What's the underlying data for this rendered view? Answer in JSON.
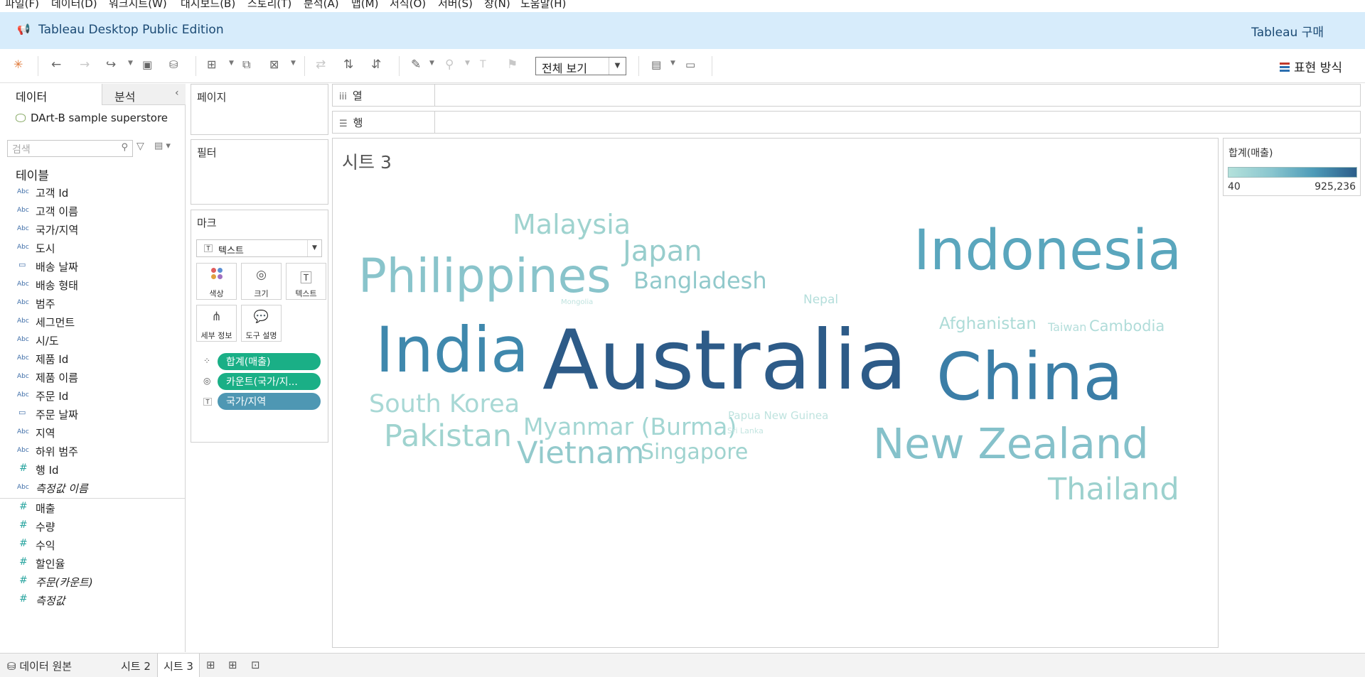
{
  "menu": [
    "파일(F)",
    "데이터(D)",
    "워크시트(W)",
    "대시보드(B)",
    "스토리(T)",
    "분석(A)",
    "맵(M)",
    "서식(O)",
    "서버(S)",
    "창(N)",
    "도움말(H)"
  ],
  "app": {
    "title": "Tableau Desktop Public Edition",
    "buy_label": "Tableau 구매"
  },
  "toolbar": {
    "view_select": "전체 보기",
    "show_me": "표현 방식"
  },
  "datapane": {
    "tab_data": "데이터",
    "tab_analysis": "분석",
    "datasource": "DArt-B sample superstore",
    "search_placeholder": "검색",
    "tables_title": "테이블",
    "dimensions": [
      {
        "type": "Abc",
        "name": "고객 Id"
      },
      {
        "type": "Abc",
        "name": "고객 이름"
      },
      {
        "type": "Abc",
        "name": "국가/지역"
      },
      {
        "type": "Abc",
        "name": "도시"
      },
      {
        "type": "date",
        "name": "배송 날짜"
      },
      {
        "type": "Abc",
        "name": "배송 형태"
      },
      {
        "type": "Abc",
        "name": "범주"
      },
      {
        "type": "Abc",
        "name": "세그먼트"
      },
      {
        "type": "Abc",
        "name": "시/도"
      },
      {
        "type": "Abc",
        "name": "제품 Id"
      },
      {
        "type": "Abc",
        "name": "제품 이름"
      },
      {
        "type": "Abc",
        "name": "주문 Id"
      },
      {
        "type": "date",
        "name": "주문 날짜"
      },
      {
        "type": "Abc",
        "name": "지역"
      },
      {
        "type": "Abc",
        "name": "하위 범주"
      },
      {
        "type": "#",
        "name": "행 Id"
      },
      {
        "type": "Abc",
        "name": "측정값 이름",
        "italic": true
      }
    ],
    "measures": [
      {
        "type": "#",
        "name": "매출"
      },
      {
        "type": "#",
        "name": "수량"
      },
      {
        "type": "#",
        "name": "수익"
      },
      {
        "type": "#",
        "name": "할인율"
      },
      {
        "type": "#",
        "name": "주문(카운트)",
        "italic": true
      },
      {
        "type": "#",
        "name": "측정값",
        "italic": true
      }
    ]
  },
  "cards": {
    "pages": "페이지",
    "filters": "필터",
    "marks": "마크",
    "mark_type": "텍스트",
    "mark_buttons": [
      "색상",
      "크기",
      "텍스트",
      "세부 정보",
      "도구 설명"
    ],
    "pills": [
      {
        "icon": "color-dots-icon",
        "label": "합계(매출)",
        "color": "#1aaf86"
      },
      {
        "icon": "size-icon",
        "label": "카운트(국가/지...",
        "color": "#1aaf86"
      },
      {
        "icon": "text-icon",
        "label": "국가/지역",
        "color": "#4e97b3"
      }
    ]
  },
  "shelves": {
    "columns": "열",
    "rows": "행"
  },
  "sheet": {
    "title": "시트 3"
  },
  "legend": {
    "title": "합계(매출)",
    "min": "40",
    "max": "925,236"
  },
  "wordcloud": [
    {
      "word": "Malaysia",
      "color": "#9fd3cf"
    },
    {
      "word": "Japan",
      "color": "#97cdcc"
    },
    {
      "word": "Philippines",
      "color": "#89c4cb"
    },
    {
      "word": "Indonesia",
      "color": "#5aa6bd"
    },
    {
      "word": "Mongolia",
      "color": "#bfe3df"
    },
    {
      "word": "Bangladesh",
      "color": "#91c9cb"
    },
    {
      "word": "Nepal",
      "color": "#b4dedb"
    },
    {
      "word": "Afghanistan",
      "color": "#addbd7"
    },
    {
      "word": "Taiwan",
      "color": "#b4dedb"
    },
    {
      "word": "Cambodia",
      "color": "#b0dcd9"
    },
    {
      "word": "India",
      "color": "#3f88ad"
    },
    {
      "word": "Australia",
      "color": "#2d5b88"
    },
    {
      "word": "China",
      "color": "#3b7ea7"
    },
    {
      "word": "South Korea",
      "color": "#a8d8d5"
    },
    {
      "word": "Myanmar (Burma)",
      "color": "#a3d6d3"
    },
    {
      "word": "Papua New Guinea",
      "color": "#bfe3df"
    },
    {
      "word": "Sri Lanka",
      "color": "#c4e5e1"
    },
    {
      "word": "Pakistan",
      "color": "#9fd3cf"
    },
    {
      "word": "Vietnam",
      "color": "#93cacc"
    },
    {
      "word": "Singapore",
      "color": "#9fd3cf"
    },
    {
      "word": "New Zealand",
      "color": "#85c1ca"
    },
    {
      "word": "Thailand",
      "color": "#9cd1ce"
    }
  ],
  "bottom": {
    "datasource_tab": "데이터 원본",
    "sheets": [
      "시트 2",
      "시트 3"
    ]
  }
}
